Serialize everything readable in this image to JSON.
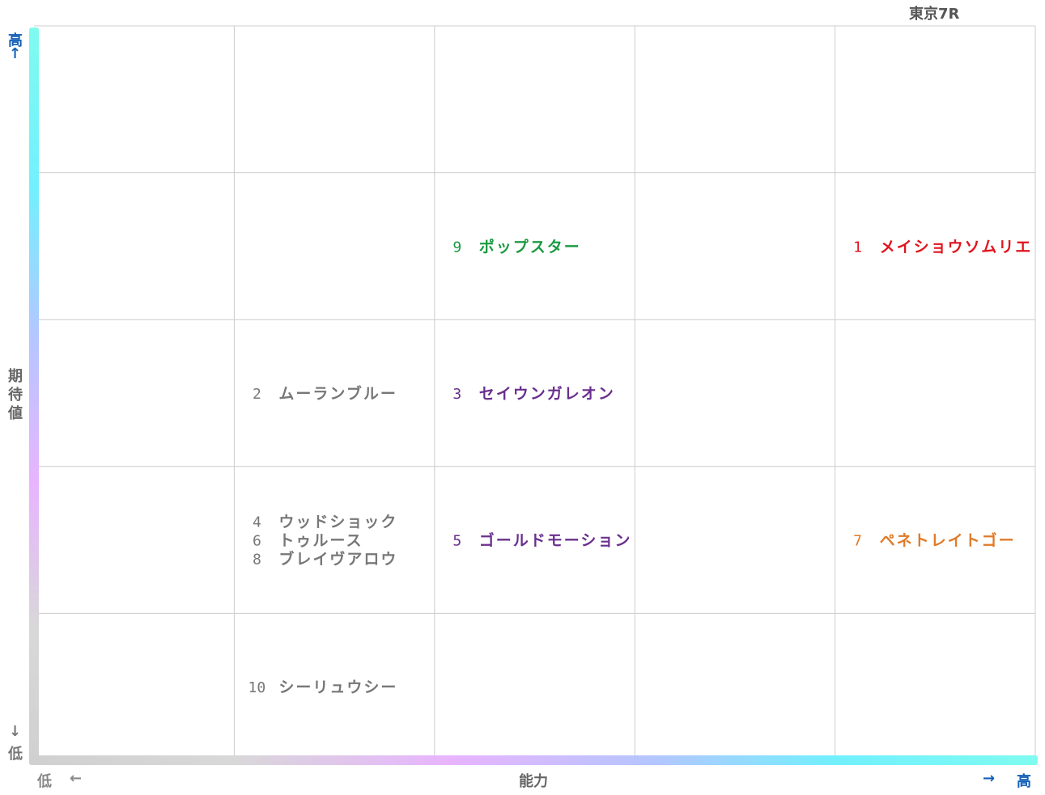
{
  "chart_data": {
    "type": "scatter",
    "title": "東京7R",
    "xlabel": "能力",
    "ylabel": "期待値",
    "x_axis": {
      "low": "低",
      "low_arrow": "←",
      "high_arrow": "→",
      "high": "高",
      "columns": 5
    },
    "y_axis": {
      "high": "高",
      "high_arrow": "↑",
      "low_arrow": "↓",
      "low": "低",
      "rows": 5
    },
    "grid": true,
    "points": [
      {
        "number": "9",
        "name": "ポップスター",
        "col": 3,
        "row": 2,
        "line": 0,
        "color": "#1a9a40"
      },
      {
        "number": "1",
        "name": "メイショウソムリエ",
        "col": 5,
        "row": 2,
        "line": 0,
        "color": "#e0141e"
      },
      {
        "number": "2",
        "name": "ムーランブルー",
        "col": 2,
        "row": 3,
        "line": 0,
        "color": "#777777"
      },
      {
        "number": "3",
        "name": "セイウンガレオン",
        "col": 3,
        "row": 3,
        "line": 0,
        "color": "#6a2f8e"
      },
      {
        "number": "4",
        "name": "ウッドショック",
        "col": 2,
        "row": 4,
        "line": -1,
        "color": "#777777"
      },
      {
        "number": "6",
        "name": "トゥルース",
        "col": 2,
        "row": 4,
        "line": 0,
        "color": "#777777"
      },
      {
        "number": "8",
        "name": "ブレイヴアロウ",
        "col": 2,
        "row": 4,
        "line": 1,
        "color": "#777777"
      },
      {
        "number": "5",
        "name": "ゴールドモーション",
        "col": 3,
        "row": 4,
        "line": 0,
        "color": "#6a2f8e"
      },
      {
        "number": "7",
        "name": "ペネトレイトゴー",
        "col": 5,
        "row": 4,
        "line": 0,
        "color": "#e07a28"
      },
      {
        "number": "10",
        "name": "シーリュウシー",
        "col": 2,
        "row": 5,
        "line": 0,
        "color": "#777777"
      }
    ]
  },
  "colors": {
    "grid": "#cccccc",
    "axis_label": "#666666",
    "arrow_accent": "#1560b8",
    "gradient_cyan": "#7ffbef",
    "gradient_blue": "#9ec9ff",
    "gradient_pink": "#e8b4ff",
    "gradient_gray": "#d4d4d4"
  }
}
